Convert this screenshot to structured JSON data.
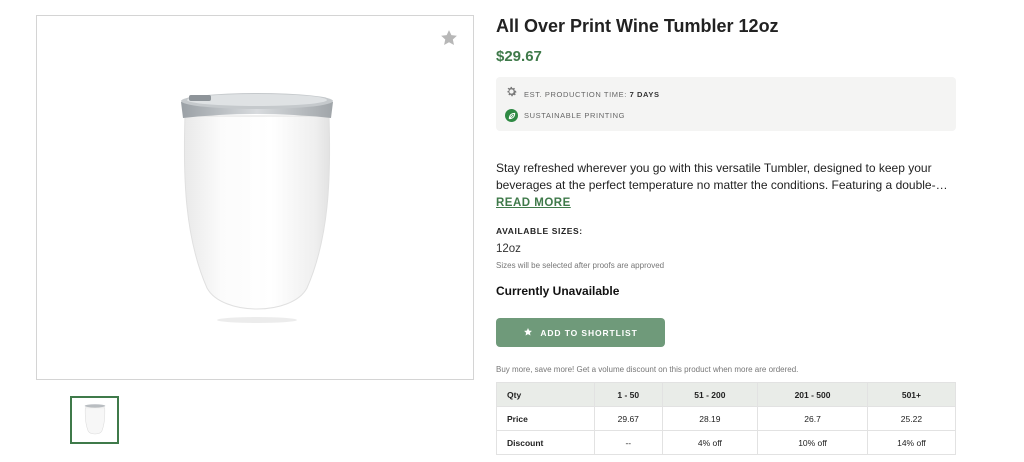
{
  "product": {
    "title": "All Over Print Wine Tumbler 12oz",
    "price": "$29.67",
    "production_label": "EST. PRODUCTION TIME:",
    "production_value": "7 DAYS",
    "sustainable_label": "SUSTAINABLE PRINTING",
    "description_line1": "Stay refreshed wherever you go with this versatile Tumbler, designed to keep your",
    "description_line2": "beverages at the perfect temperature no matter the conditions. Featuring a double-…",
    "read_more": "READ MORE",
    "sizes_label": "AVAILABLE SIZES:",
    "size_value": "12oz",
    "size_note": "Sizes will be selected after proofs are approved",
    "availability": "Currently Unavailable",
    "shortlist_button": "ADD TO SHORTLIST",
    "discount_note": "Buy more, save more! Get a volume discount on this product when more are ordered."
  },
  "pricing_table": {
    "rows": [
      {
        "label": "Qty",
        "cells": [
          "1 - 50",
          "51 - 200",
          "201 - 500",
          "501+"
        ]
      },
      {
        "label": "Price",
        "cells": [
          "29.67",
          "28.19",
          "26.7",
          "25.22"
        ]
      },
      {
        "label": "Discount",
        "cells": [
          "--",
          "4% off",
          "10% off",
          "14% off"
        ]
      }
    ]
  },
  "icons": {
    "favorite": "star-icon",
    "production": "gear-icon",
    "sustainable": "leaf-icon",
    "shortlist": "star-icon"
  },
  "colors": {
    "accent_green": "#3f7a4a",
    "button_green": "#6f9a7a",
    "meta_bg": "#f4f4f3",
    "table_header_bg": "#e9ece8"
  }
}
